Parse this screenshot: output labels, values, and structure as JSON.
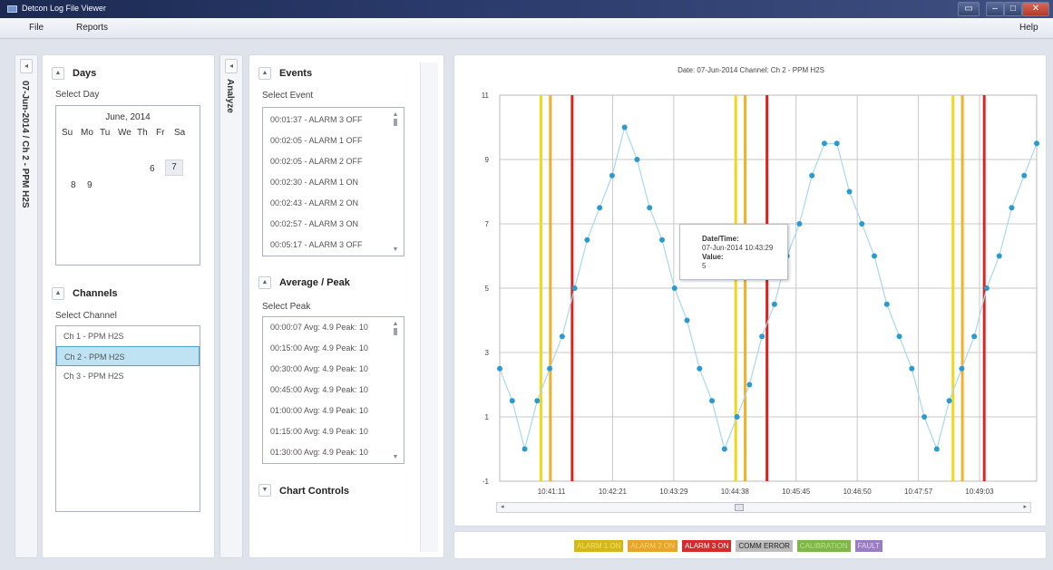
{
  "window": {
    "title": "Detcon Log File Viewer"
  },
  "menu": {
    "file": "File",
    "reports": "Reports",
    "help": "Help"
  },
  "sidebar_left": {
    "vertical_label": "07-Jun-2014 / Ch 2 - PPM H2S",
    "collapse_glyph": "◂"
  },
  "sidebar_analyze": {
    "label": "Analyze",
    "collapse_glyph": "◂"
  },
  "days": {
    "title": "Days",
    "select_label": "Select Day",
    "month": "June, 2014",
    "weekdays": [
      "Su",
      "Mo",
      "Tu",
      "We",
      "Th",
      "Fr",
      "Sa"
    ],
    "row1": [
      "6",
      "7"
    ],
    "row2": [
      "8",
      "9"
    ],
    "selected_day": "7"
  },
  "channels": {
    "title": "Channels",
    "select_label": "Select Channel",
    "items": [
      "Ch 1 - PPM H2S",
      "Ch 2 - PPM H2S",
      "Ch 3 - PPM H2S"
    ],
    "selected": "Ch 2 - PPM H2S"
  },
  "events": {
    "title": "Events",
    "select_label": "Select Event",
    "items": [
      "00:01:37 - ALARM 3 OFF",
      "00:02:05 - ALARM 1 OFF",
      "00:02:05 - ALARM 2 OFF",
      "00:02:30 - ALARM 1 ON",
      "00:02:43 - ALARM 2 ON",
      "00:02:57 - ALARM 3 ON",
      "00:05:17 - ALARM 3 OFF"
    ]
  },
  "average_peak": {
    "title": "Average / Peak",
    "select_label": "Select Peak",
    "items": [
      "00:00:07 Avg: 4.9 Peak: 10",
      "00:15:00 Avg: 4.9 Peak: 10",
      "00:30:00 Avg: 4.9 Peak: 10",
      "00:45:00 Avg: 4.9 Peak: 10",
      "01:00:00 Avg: 4.9 Peak: 10",
      "01:15:00 Avg: 4.9 Peak: 10",
      "01:30:00 Avg: 4.9 Peak: 10"
    ]
  },
  "chart_controls": {
    "title": "Chart Controls"
  },
  "tooltip": {
    "label_datetime": "Date/Time:",
    "value_datetime": "07-Jun-2014 10:43:29",
    "label_value": "Value:",
    "value": "5"
  },
  "legend": {
    "items": [
      {
        "label": "ALARM 1 ON",
        "bg": "#d4b81a",
        "fg": "#f3e06a"
      },
      {
        "label": "ALARM 2 ON",
        "bg": "#e7a52a",
        "fg": "#f7d37c"
      },
      {
        "label": "ALARM 3 ON",
        "bg": "#d52b2b",
        "fg": "#ffffff"
      },
      {
        "label": "COMM ERROR",
        "bg": "#bdbdbd",
        "fg": "#222222"
      },
      {
        "label": "CALIBRATION",
        "bg": "#7fb64a",
        "fg": "#b9e28c"
      },
      {
        "label": "FAULT",
        "bg": "#9a7cc2",
        "fg": "#e4d6f5"
      }
    ]
  },
  "colors": {
    "series": "#2a9ad0",
    "series_line": "#a7d8ee",
    "alarm1": "#f2d81a",
    "alarm2": "#f3b12a",
    "alarm3": "#e0221f",
    "grid": "#c9c9c9"
  },
  "chart_data": {
    "type": "line",
    "title": "Date: 07-Jun-2014   Channel: Ch 2 - PPM H2S",
    "ylim": [
      -1,
      11
    ],
    "y_ticks": [
      "11",
      "9",
      "7",
      "5",
      "3",
      "1",
      "-1"
    ],
    "x_ticks": [
      "10:41:11",
      "10:42:21",
      "10:43:29",
      "10:44:38",
      "10:45:45",
      "10:46:50",
      "10:47:57",
      "10:49:03"
    ],
    "series": [
      {
        "values": [
          2.5,
          1.5,
          0,
          1.5,
          2.5,
          3.5,
          5,
          6.5,
          7.5,
          8.5,
          10,
          9,
          7.5,
          6.5,
          5,
          4,
          2.5,
          1.5,
          0,
          1,
          2,
          3.5,
          4.5,
          6,
          7,
          8.5,
          9.5,
          9.5,
          8,
          7,
          6,
          4.5,
          3.5,
          2.5,
          1,
          0,
          1.5,
          2.5,
          3.5,
          5,
          6,
          7.5,
          8.5,
          9.5
        ]
      }
    ],
    "alarm_lines": [
      {
        "type": "ALARM 1",
        "at_index": 3.3
      },
      {
        "type": "ALARM 2",
        "at_index": 4.05
      },
      {
        "type": "ALARM 3",
        "at_index": 5.8
      },
      {
        "type": "ALARM 1",
        "at_index": 18.9
      },
      {
        "type": "ALARM 2",
        "at_index": 19.65
      },
      {
        "type": "ALARM 3",
        "at_index": 21.4
      },
      {
        "type": "ALARM 1",
        "at_index": 36.3
      },
      {
        "type": "ALARM 2",
        "at_index": 37.05
      },
      {
        "type": "ALARM 3",
        "at_index": 38.8
      }
    ],
    "highlighted_index": 14,
    "grid": true
  }
}
